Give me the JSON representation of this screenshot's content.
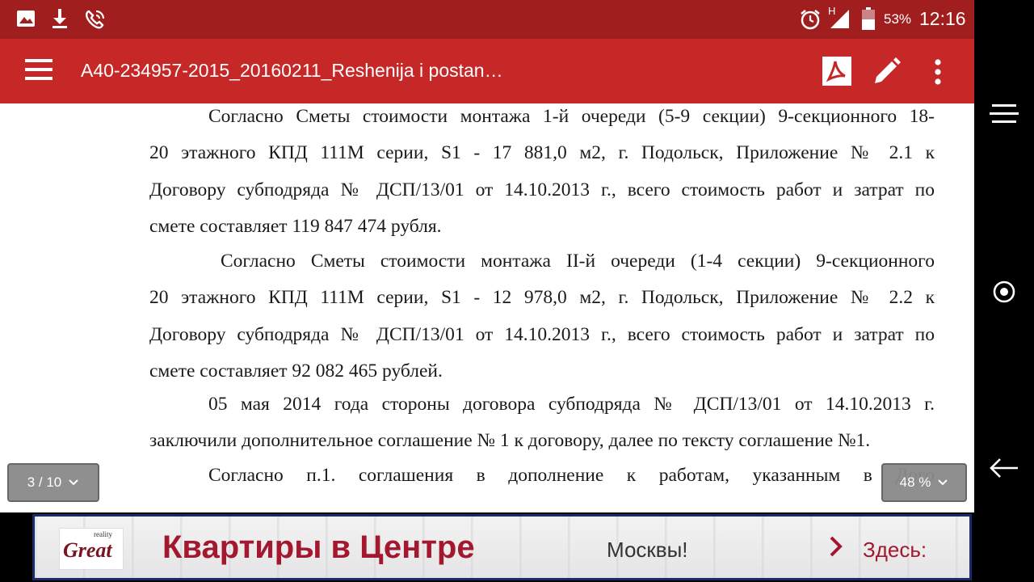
{
  "status_bar": {
    "network": "H",
    "battery": "53%",
    "time": "12:16"
  },
  "toolbar": {
    "title": "A40-234957-2015_20160211_Reshenija i postan…"
  },
  "document": {
    "paragraphs": [
      {
        "lines": [
          "Согласно Сметы стоимости монтажа 1-й очереди (5-9 секции) 9-секционного 18-",
          "20 этажного КПД 111М серии, S1 - 17 881,0 м2, г. Подольск, Приложение № 2.1 к",
          "Договору субподряда № ДСП/13/01 от 14.10.2013 г., всего стоимость работ и затрат по",
          "смете составляет 119 847 474 рубля."
        ]
      },
      {
        "lines": [
          "Согласно Сметы стоимости монтажа II-й очереди (1-4 секции) 9-секционного",
          "20 этажного КПД 111М серии, S1 - 12 978,0 м2, г. Подольск, Приложение № 2.2 к",
          "Договору субподряда № ДСП/13/01 от 14.10.2013 г., всего стоимость работ и затрат по",
          "смете составляет 92 082 465 рублей."
        ]
      },
      {
        "lines": [
          "05 мая 2014 года стороны договора субподряда № ДСП/13/01 от 14.10.2013 г.",
          "заключили дополнительное соглашение № 1 к договору, далее по тексту соглашение №1."
        ]
      },
      {
        "lines": [
          "Согласно п.1. соглашения в дополнение к работам, указанным в Дого"
        ]
      }
    ]
  },
  "page_indicator": "3 / 10",
  "zoom_indicator": "48 %",
  "ad": {
    "logo_top": "reality",
    "logo_main": "Great",
    "headline": "Квартиры в Центре",
    "city": "Москвы!",
    "cta": "Здесь:"
  },
  "colors": {
    "status_bar": "#a11e1e",
    "toolbar": "#c62828",
    "ad_accent": "#a3182e",
    "ad_border": "#1b2a6b"
  }
}
